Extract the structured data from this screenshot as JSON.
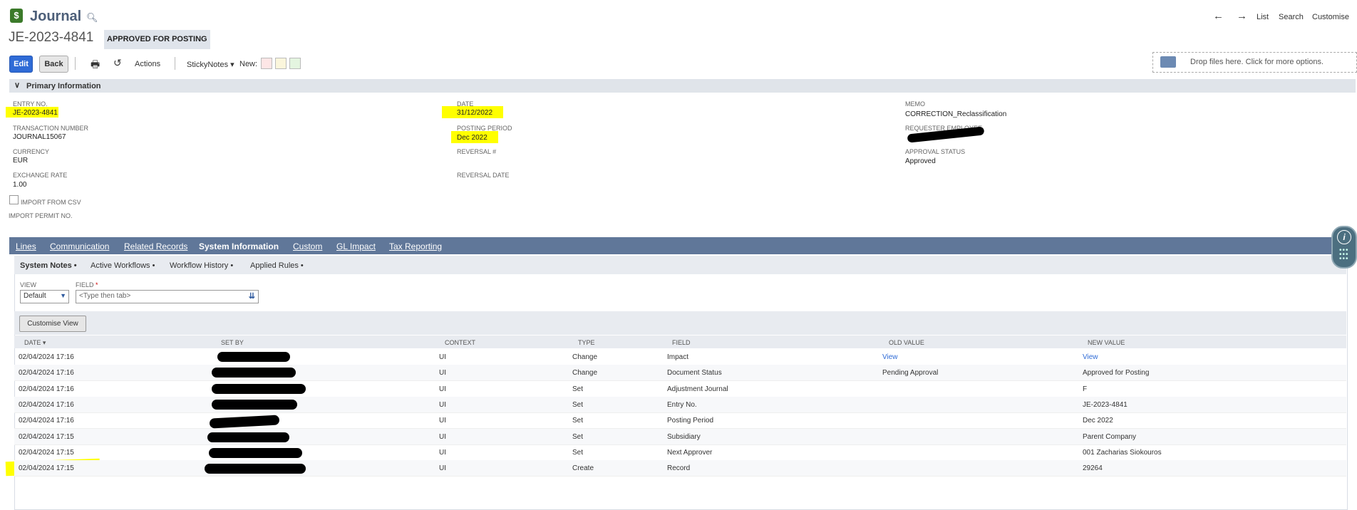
{
  "header": {
    "app_title": "Journal",
    "record_id": "JE-2023-4841",
    "status": "APPROVED FOR POSTING",
    "nav": {
      "list": "List",
      "search": "Search",
      "customise": "Customise"
    }
  },
  "toolbar": {
    "edit": "Edit",
    "back": "Back",
    "actions": "Actions",
    "sticky_notes": "StickyNotes",
    "new_label": "New:",
    "note_colors": [
      "#fde6e6",
      "#fbf6dc",
      "#e4f5e0"
    ],
    "dropzone": "Drop files here. Click for more options."
  },
  "primary": {
    "title": "Primary Information",
    "col1": [
      {
        "label": "ENTRY NO.",
        "value": "JE-2023-4841"
      },
      {
        "label": "TRANSACTION NUMBER",
        "value": "JOURNAL15067"
      },
      {
        "label": "CURRENCY",
        "value": "EUR"
      },
      {
        "label": "EXCHANGE RATE",
        "value": "1.00"
      }
    ],
    "import_csv": "IMPORT FROM CSV",
    "import_permit": "IMPORT PERMIT NO.",
    "col2": [
      {
        "label": "DATE",
        "value": "31/12/2022"
      },
      {
        "label": "POSTING PERIOD",
        "value": "Dec 2022"
      },
      {
        "label": "REVERSAL #",
        "value": ""
      },
      {
        "label": "REVERSAL DATE",
        "value": ""
      }
    ],
    "col3": [
      {
        "label": "MEMO",
        "value": "CORRECTION_Reclassification"
      },
      {
        "label": "REQUESTER EMPLOYEE",
        "value": ""
      },
      {
        "label": "APPROVAL STATUS",
        "value": "Approved"
      }
    ]
  },
  "tabs": [
    "Lines",
    "Communication",
    "Related Records",
    "System Information",
    "Custom",
    "GL Impact",
    "Tax Reporting"
  ],
  "subtabs": [
    "System Notes •",
    "Active Workflows •",
    "Workflow History •",
    "Applied Rules •"
  ],
  "filters": {
    "view_label": "VIEW",
    "view_value": "Default",
    "field_label": "FIELD",
    "field_required": "*",
    "field_placeholder": "<Type then tab>",
    "customise_view": "Customise View"
  },
  "table": {
    "headers": [
      "DATE ▾",
      "SET BY",
      "CONTEXT",
      "TYPE",
      "FIELD",
      "OLD VALUE",
      "NEW VALUE"
    ],
    "rows": [
      {
        "date": "02/04/2024 17:16",
        "context": "UI",
        "type": "Change",
        "field": "Impact",
        "old": "View",
        "new": "View"
      },
      {
        "date": "02/04/2024 17:16",
        "context": "UI",
        "type": "Change",
        "field": "Document Status",
        "old": "Pending Approval",
        "new": "Approved for Posting"
      },
      {
        "date": "02/04/2024 17:16",
        "context": "UI",
        "type": "Set",
        "field": "Adjustment Journal",
        "old": "",
        "new": "F"
      },
      {
        "date": "02/04/2024 17:16",
        "context": "UI",
        "type": "Set",
        "field": "Entry No.",
        "old": "",
        "new": "JE-2023-4841"
      },
      {
        "date": "02/04/2024 17:16",
        "context": "UI",
        "type": "Set",
        "field": "Posting Period",
        "old": "",
        "new": "Dec 2022"
      },
      {
        "date": "02/04/2024 17:15",
        "context": "UI",
        "type": "Set",
        "field": "Subsidiary",
        "old": "",
        "new": "Parent Company"
      },
      {
        "date": "02/04/2024 17:15",
        "context": "UI",
        "type": "Set",
        "field": "Next Approver",
        "old": "",
        "new": "001 Zacharias Siokouros"
      },
      {
        "date": "02/04/2024 17:15",
        "context": "UI",
        "type": "Create",
        "field": "Record",
        "old": "",
        "new": "29264"
      }
    ]
  },
  "colors": {
    "tab_bar": "#607799",
    "edit_button": "#2f6bd6",
    "highlight": "#ffff00",
    "link": "#2f6bd6"
  }
}
